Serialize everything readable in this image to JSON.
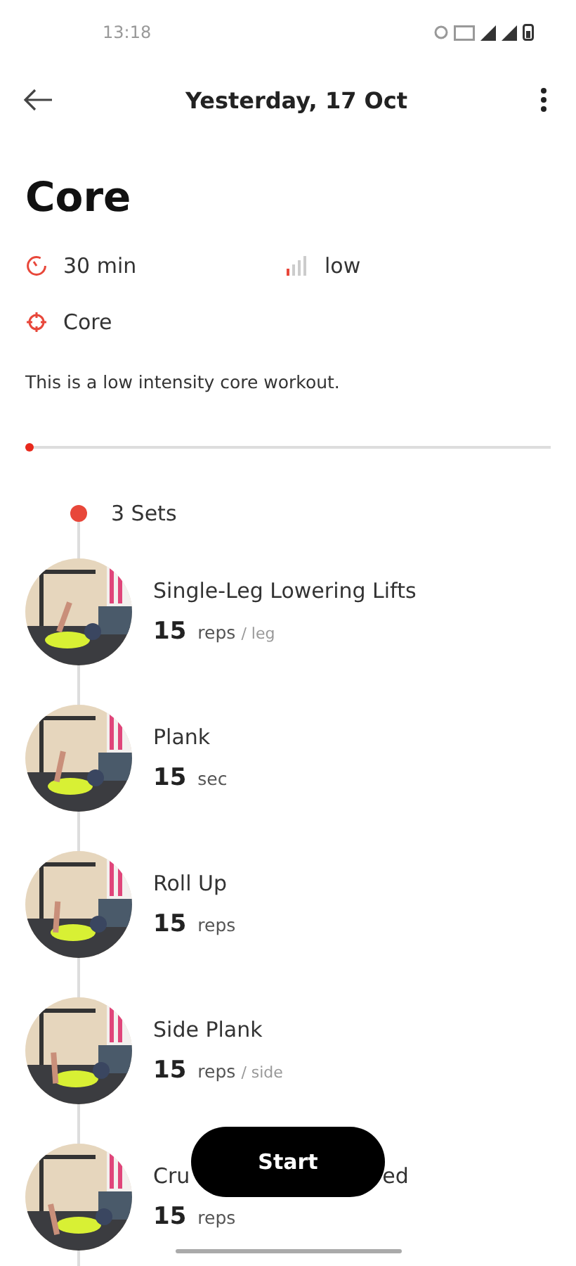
{
  "status_bar": {
    "time": "13:18"
  },
  "header": {
    "title": "Yesterday, 17 Oct"
  },
  "workout": {
    "title": "Core",
    "duration": "30 min",
    "intensity": "low",
    "intensity_meter": {
      "level": 0.25
    },
    "focus": "Core",
    "description": "This is a low intensity core workout."
  },
  "progress": {
    "level": 0
  },
  "sets": {
    "label": "3 Sets"
  },
  "exercises": [
    {
      "name_parts": [
        "Single-Leg Lowering Lifts"
      ],
      "amount": "15",
      "unit": "reps",
      "per": "/ leg"
    },
    {
      "name_parts": [
        "Plank"
      ],
      "amount": "15",
      "unit": "sec"
    },
    {
      "name_parts": [
        "Roll Up"
      ],
      "amount": "15",
      "unit": "reps"
    },
    {
      "name_parts": [
        "Side Plank"
      ],
      "amount": "15",
      "unit": "reps",
      "per": "/ side"
    },
    {
      "name_parts": [
        "Cru",
        "ed"
      ],
      "amount": "15",
      "unit": "reps"
    }
  ],
  "start_button": {
    "label": "Start"
  }
}
